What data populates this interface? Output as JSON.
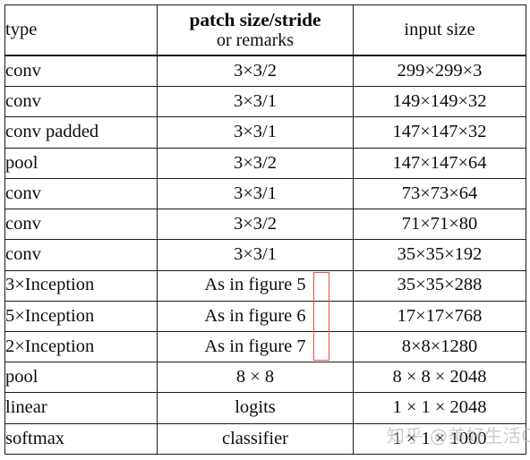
{
  "table": {
    "headers": [
      {
        "label": "type"
      },
      {
        "label": "patch size/stride",
        "sublabel": "or remarks"
      },
      {
        "label": "input size"
      }
    ],
    "rows": [
      {
        "type": "conv",
        "patch": "3×3/2",
        "input": "299×299×3"
      },
      {
        "type": "conv",
        "patch": "3×3/1",
        "input": "149×149×32"
      },
      {
        "type": "conv padded",
        "patch": "3×3/1",
        "input": "147×147×32"
      },
      {
        "type": "pool",
        "patch": "3×3/2",
        "input": "147×147×64"
      },
      {
        "type": "conv",
        "patch": "3×3/1",
        "input": "73×73×64"
      },
      {
        "type": "conv",
        "patch": "3×3/2",
        "input": "71×71×80"
      },
      {
        "type": "conv",
        "patch": "3×3/1",
        "input": "35×35×192"
      },
      {
        "type": "3×Inception",
        "patch": "As in figure 5",
        "input": "35×35×288"
      },
      {
        "type": "5×Inception",
        "patch": "As in figure 6",
        "input": "17×17×768"
      },
      {
        "type": "2×Inception",
        "patch": "As in figure 7",
        "input": "8×8×1280"
      },
      {
        "type": "pool",
        "patch": "8 × 8",
        "input": "8 × 8 × 2048"
      },
      {
        "type": "linear",
        "patch": "logits",
        "input": "1 × 1 × 2048"
      },
      {
        "type": "softmax",
        "patch": "classifier",
        "input": "1 × 1 × 1000"
      }
    ]
  },
  "annotation": {
    "figure_box_color": "#e8534a",
    "figure_box_targets": "5, 6, 7"
  },
  "watermark": {
    "text": "知乎 @美好生活OK",
    "color": "#b9b9b9"
  }
}
